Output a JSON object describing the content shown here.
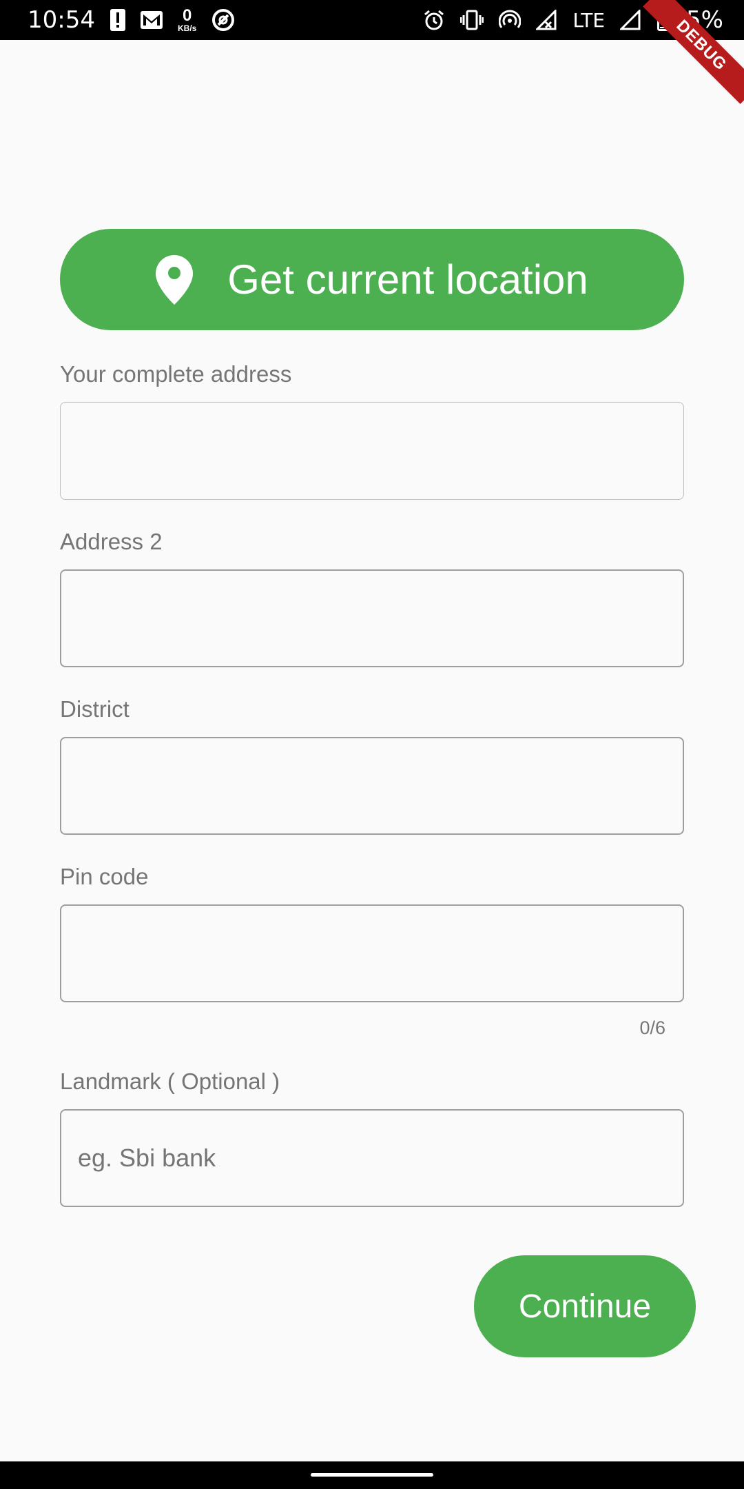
{
  "status_bar": {
    "time": "10:54",
    "data_rate_value": "0",
    "data_rate_unit": "KB/s",
    "network": "LTE",
    "battery": "5%",
    "icons": [
      "alert-icon",
      "gmail-icon",
      "data-rate-icon",
      "nfc-icon",
      "alarm-icon",
      "vibrate-icon",
      "hotspot-icon",
      "signal-icon",
      "signal-icon",
      "battery-icon"
    ]
  },
  "debug_banner": "DEBUG",
  "location_button": {
    "label": "Get current location",
    "icon": "location-pin-icon"
  },
  "form": {
    "address": {
      "label": "Your complete address",
      "value": "",
      "placeholder": ""
    },
    "address2": {
      "label": "Address 2",
      "value": "",
      "placeholder": ""
    },
    "district": {
      "label": "District",
      "value": "",
      "placeholder": ""
    },
    "pincode": {
      "label": "Pin code",
      "value": "",
      "placeholder": "",
      "counter": "0/6"
    },
    "landmark": {
      "label": "Landmark ( Optional )",
      "value": "",
      "placeholder": "eg. Sbi bank"
    }
  },
  "continue_button": {
    "label": "Continue"
  },
  "colors": {
    "accent": "#4caf50",
    "background": "#fafafa",
    "label": "#757575",
    "border": "#9e9e9e",
    "debug": "#b71c1c"
  }
}
